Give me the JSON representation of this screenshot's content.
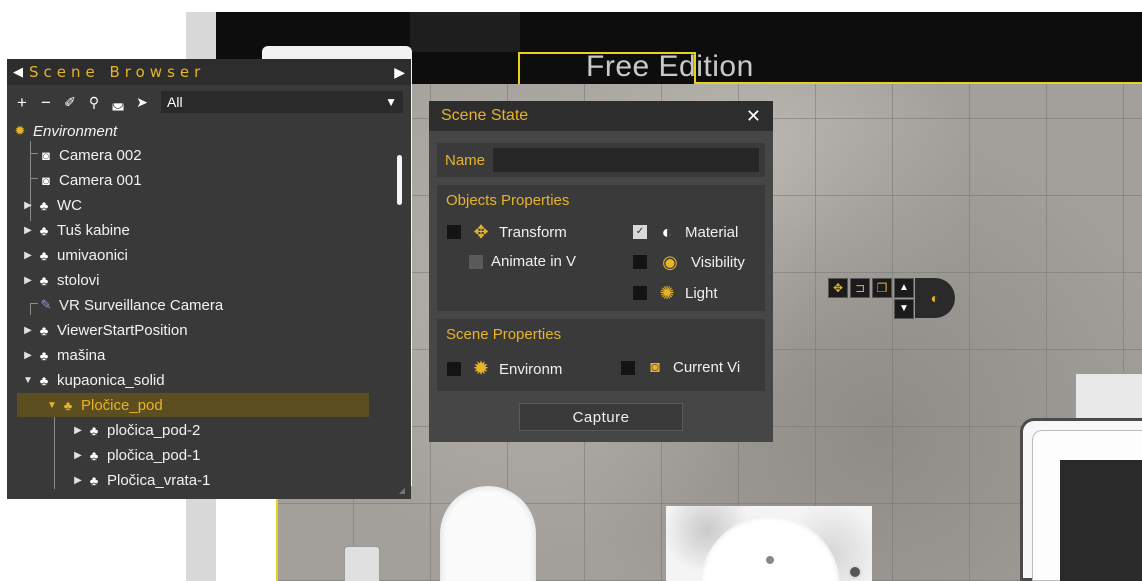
{
  "viewport": {
    "watermark": "Free Edition"
  },
  "scene_browser": {
    "title": "Scene Browser",
    "collapse_icon": "triangle-left-icon",
    "pin_icon": "double-arrow-right-icon",
    "toolbar": {
      "icons": [
        "plus-icon",
        "minus-icon",
        "tag-icon",
        "search-icon",
        "camera-move-icon",
        "cursor-icon"
      ],
      "filter_value": "All"
    },
    "tree": [
      {
        "label": "Environment",
        "icon": "sun-icon",
        "italic": true,
        "expander": "none"
      },
      {
        "label": "Camera 002",
        "icon": "camera-icon",
        "expander": "none"
      },
      {
        "label": "Camera 001",
        "icon": "camera-icon",
        "expander": "none"
      },
      {
        "label": "WC",
        "icon": "group-icon",
        "expander": "collapsed"
      },
      {
        "label": "Tuš kabine",
        "icon": "group-icon",
        "expander": "collapsed"
      },
      {
        "label": "umivaonici",
        "icon": "group-icon",
        "expander": "collapsed"
      },
      {
        "label": "stolovi",
        "icon": "group-icon",
        "expander": "collapsed"
      },
      {
        "label": "VR Surveillance Camera",
        "icon": "vr-camera-icon",
        "expander": "none"
      },
      {
        "label": "ViewerStartPosition",
        "icon": "group-icon",
        "expander": "collapsed"
      },
      {
        "label": "mašina",
        "icon": "group-icon",
        "expander": "collapsed"
      },
      {
        "label": "kupaonica_solid",
        "icon": "group-icon",
        "expander": "expanded"
      },
      {
        "label": "Pločice_pod",
        "icon": "group-icon",
        "expander": "expanded",
        "selected": true
      },
      {
        "label": "pločica_pod-2",
        "icon": "group-icon",
        "expander": "collapsed"
      },
      {
        "label": "pločica_pod-1",
        "icon": "group-icon",
        "expander": "collapsed"
      },
      {
        "label": "Pločica_vrata-1",
        "icon": "group-icon",
        "expander": "collapsed"
      }
    ]
  },
  "scene_state": {
    "title": "Scene State",
    "close_icon": "close-icon",
    "name_label": "Name",
    "name_value": "",
    "objects_properties": {
      "title": "Objects Properties",
      "transform": {
        "label": "Transform",
        "checked": false,
        "icon": "move-arrows-icon"
      },
      "animate": {
        "label": "Animate in V",
        "checked": false,
        "disabled": true
      },
      "material": {
        "label": "Material",
        "checked": true,
        "icon": "material-icon"
      },
      "visibility": {
        "label": "Visibility",
        "checked": false,
        "icon": "eye-icon"
      },
      "light": {
        "label": "Light",
        "checked": false,
        "icon": "lightbulb-icon"
      }
    },
    "scene_properties": {
      "title": "Scene Properties",
      "environment": {
        "label": "Environm",
        "checked": false,
        "icon": "sun-icon"
      },
      "current_view": {
        "label": "Current Vi",
        "checked": false,
        "icon": "camera-icon"
      }
    },
    "capture_label": "Capture"
  },
  "colors": {
    "accent": "#e6b32a",
    "panel_bg": "#393939",
    "header_bg": "#2d2d2d",
    "selection_bg": "#5d4e20"
  }
}
